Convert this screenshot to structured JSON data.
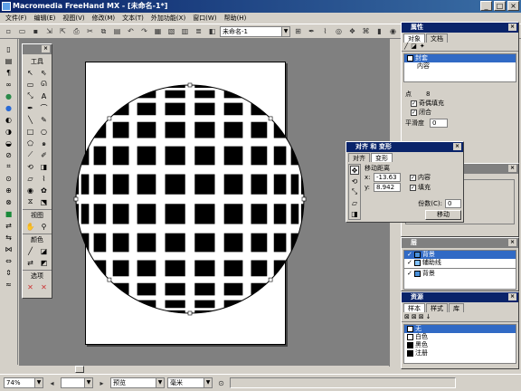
{
  "window": {
    "title": "Macromedia FreeHand MX - [未命名-1*]",
    "min": "_",
    "max": "□",
    "close": "×"
  },
  "menu": [
    "文件(F)",
    "编辑(E)",
    "视图(V)",
    "修改(M)",
    "文本(T)",
    "外加功能(X)",
    "窗口(W)",
    "帮助(H)"
  ],
  "toolbar": {
    "doc_combo": "未命名-1"
  },
  "tools_panel": {
    "title": "工具",
    "view_label": "视图",
    "color_label": "颜色",
    "options_label": "选项"
  },
  "properties_panel": {
    "title": "属性",
    "tabs": [
      "对象",
      "文档"
    ],
    "items": [
      "封套",
      "内容"
    ],
    "points_label": "点",
    "points_value": "8",
    "closed_label": "闭合",
    "even_odd_label": "奇偶填充",
    "flatness_label": "平滑度",
    "flatness_value": "0"
  },
  "transform_panel": {
    "title": "对齐 和 变形",
    "tabs": [
      "对齐",
      "变形"
    ],
    "section_label": "移动距离",
    "x_label": "x:",
    "x_value": "-13.63",
    "y_label": "y:",
    "y_value": "8.942",
    "contents_label": "内容",
    "fills_label": "填充",
    "copies_label": "份数(C):",
    "copies_value": "0",
    "move_button": "移动"
  },
  "layers_panel": {
    "title": "层",
    "layers": [
      "背景",
      "辅助线",
      "背景"
    ]
  },
  "swatches_panel": {
    "title": "资源",
    "tabs": [
      "样本",
      "样式",
      "库"
    ],
    "swatches": [
      {
        "name": "无",
        "color": "#ffffff"
      },
      {
        "name": "白色",
        "color": "#ffffff"
      },
      {
        "name": "黑色",
        "color": "#000000"
      },
      {
        "name": "注册",
        "color": "#000000"
      }
    ]
  },
  "status": {
    "zoom": "74%",
    "view_mode": "预览",
    "units": "毫米"
  },
  "artwork": {
    "grid_cells": 12,
    "grid_fill": "#000000"
  }
}
